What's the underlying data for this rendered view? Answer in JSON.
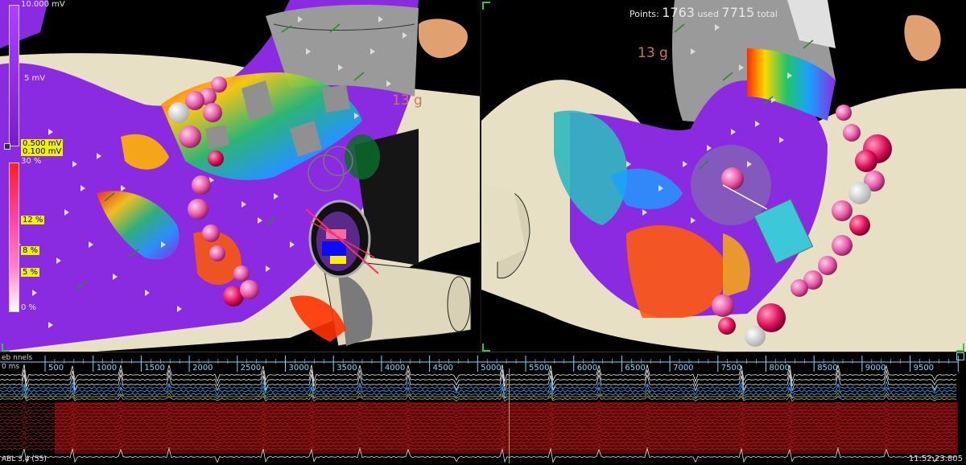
{
  "voltage_scale": {
    "max_label": "10.000 mV",
    "mid_label": "5 mV",
    "upper_threshold": "0.500 mV",
    "lower_threshold": "0.100 mV"
  },
  "percent_scale": {
    "top": "30 %",
    "p12": "12 %",
    "p8": "8 %",
    "p5": "5 %",
    "p0": "0 %"
  },
  "left_view": {
    "contact_force": "13 g"
  },
  "right_view": {
    "contact_force": "13 g",
    "points_label": "Points:",
    "points_used": "1763",
    "used_label": "used",
    "points_total": "7715",
    "total_label": "total"
  },
  "egm": {
    "header_fragment": "eb  nnels",
    "ms_fragment": "0 ms",
    "time_ticks": [
      "500",
      "1000",
      "1500",
      "2000",
      "2500",
      "3000",
      "3500",
      "4000",
      "4500",
      "5000",
      "5500",
      "6000",
      "6500",
      "7000",
      "7500",
      "8000",
      "8500",
      "9000",
      "9500"
    ],
    "bottom_channel_label": "ABL 3,4 (55)",
    "timestamp": "11:52:23.805"
  },
  "colors": {
    "purple": "#8a2be2",
    "anatomy": "#e8e0c4",
    "vessel_gray": "#8a8a8a",
    "ablation_pink": "#e85aa8",
    "trace_cyan": "#3fa9ff",
    "trace_yellow": "#d8d050",
    "trace_red": "#c01818",
    "corner_green": "#3fbf3f"
  }
}
